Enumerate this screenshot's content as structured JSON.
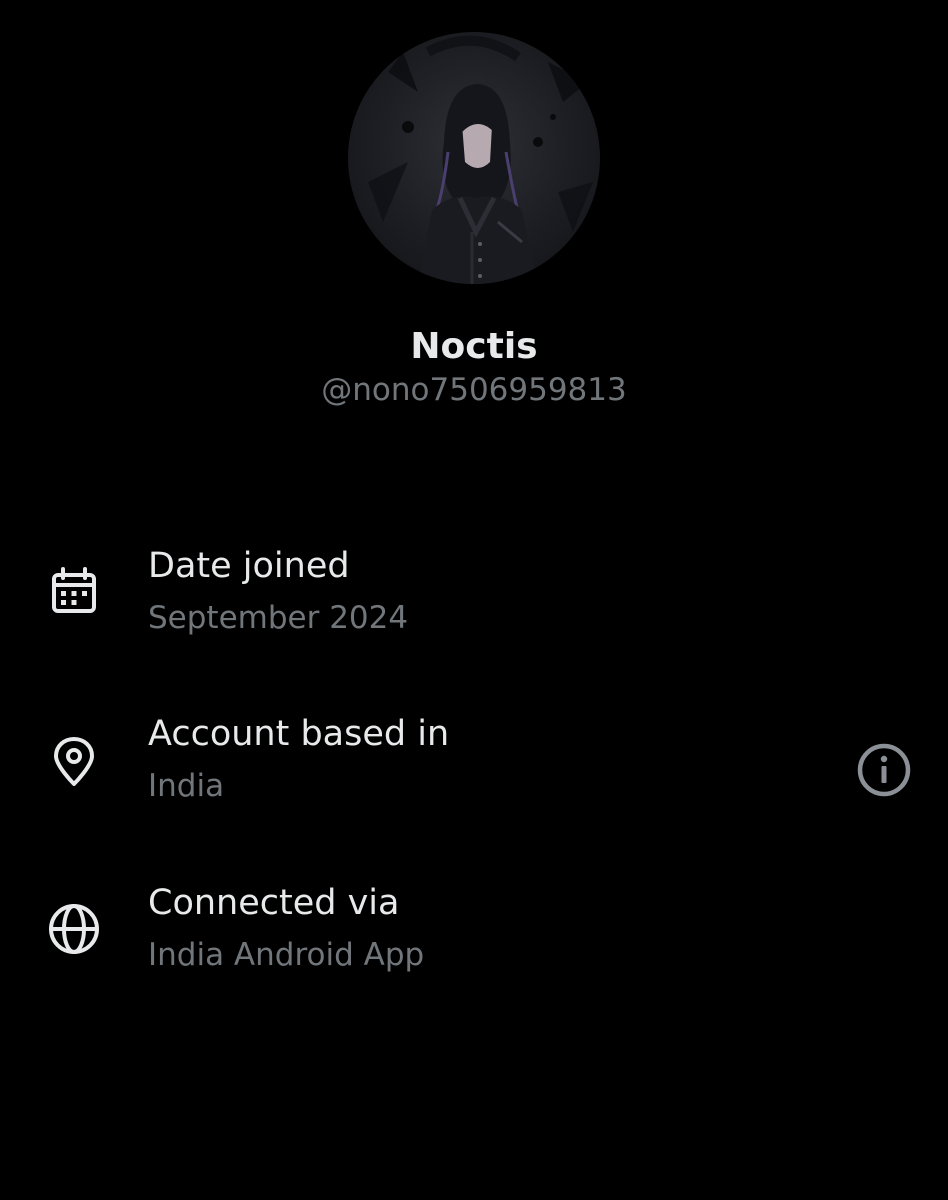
{
  "profile": {
    "display_name": "Noctis",
    "handle": "@nono7506959813"
  },
  "details": [
    {
      "icon": "calendar-icon",
      "title": "Date joined",
      "value": "September 2024"
    },
    {
      "icon": "location-pin-icon",
      "title": "Account based in",
      "value": "India",
      "info_icon": "info-icon"
    },
    {
      "icon": "globe-icon",
      "title": "Connected via",
      "value": "India Android App"
    }
  ],
  "colors": {
    "background": "#000000",
    "primary_text": "#e7e9ea",
    "secondary_text": "#71767b",
    "info_icon": "#8b9096"
  }
}
